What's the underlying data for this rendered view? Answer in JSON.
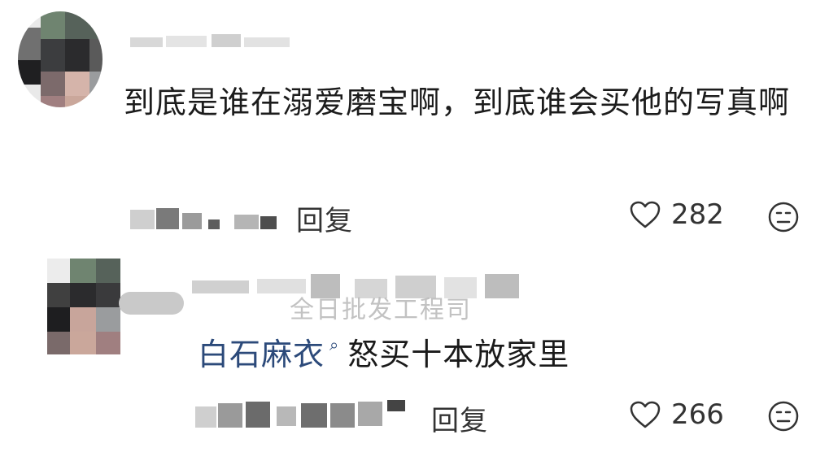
{
  "comment1": {
    "text": "到底是谁在溺爱磨宝啊，到底谁会买他的写真啊",
    "reply_label": "回复",
    "likes": "282"
  },
  "comment2": {
    "reply_to_snippet": "全日批发工程司",
    "mention": "白石麻衣",
    "text": "怒买十本放家里",
    "reply_label": "回复",
    "likes": "266"
  }
}
